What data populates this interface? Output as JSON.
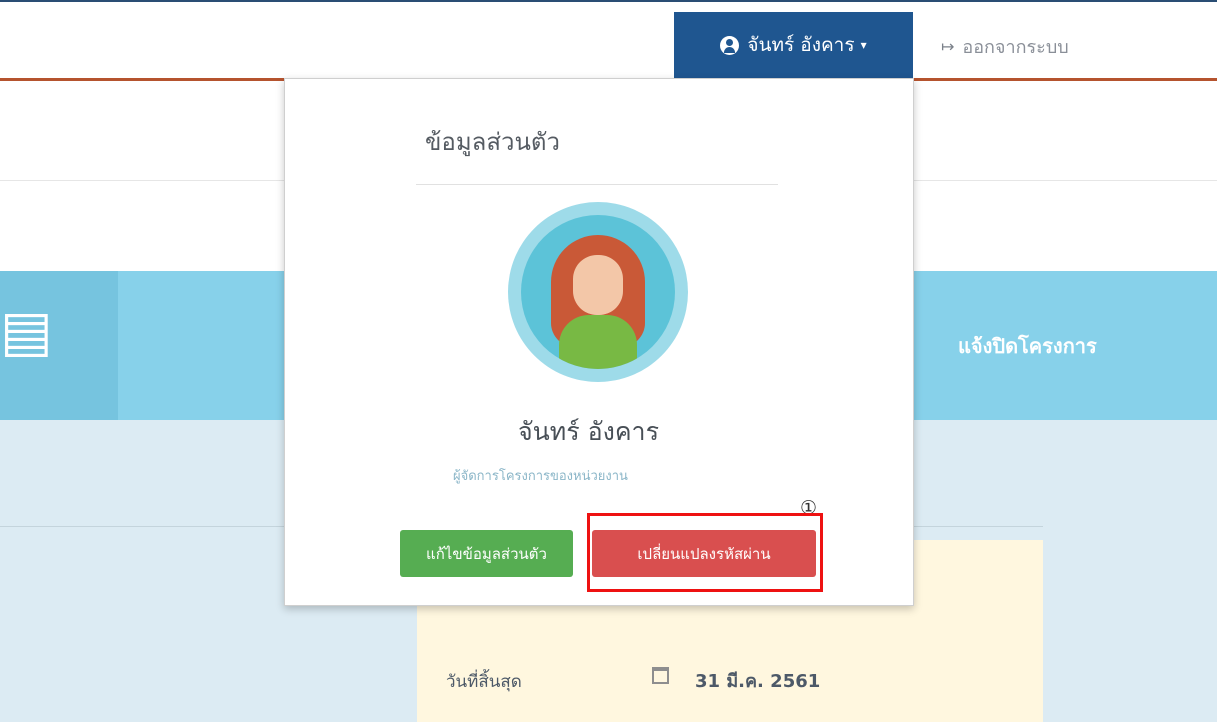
{
  "nav": {
    "user_name": "จันทร์ อังคาร",
    "user_icon": "user-circle-icon",
    "caret_glyph": "▾",
    "logout_label": "ออกจากระบบ",
    "logout_icon": "sign-out-icon"
  },
  "background": {
    "band_label": "แจ้งปิดโครงการ",
    "end_date_label": "วันที่สิ้นสุด",
    "end_date_value": "31 มี.ค. 2561",
    "book_icon": "book-icon",
    "calendar_icon": "calendar-icon"
  },
  "dropdown": {
    "title": "ข้อมูลส่วนตัว",
    "avatar_icon": "woman-avatar-icon",
    "name": "จันทร์ อังคาร",
    "role": "ผู้จัดการโครงการของหน่วยงาน",
    "edit_button": "แก้ไขข้อมูลส่วนตัว",
    "change_password_button": "เปลี่ยนแปลงรหัสผ่าน",
    "annotation": "①"
  },
  "colors": {
    "nav_active": "#1f5690",
    "accent_line": "#b5532e",
    "band": "#87d1ea",
    "edit_button": "#56ad52",
    "change_password_button": "#d94f4f",
    "highlight": "#ee1111"
  }
}
